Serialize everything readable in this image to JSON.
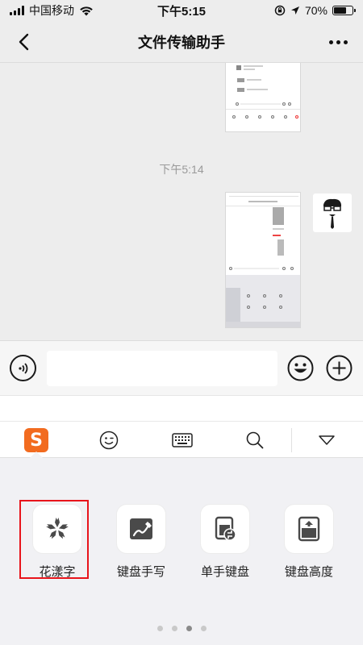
{
  "status_bar": {
    "carrier": "中国移动",
    "time": "下午5:15",
    "battery": "70%",
    "battery_level": 0.7
  },
  "nav": {
    "title": "文件传输助手"
  },
  "chat": {
    "timestamp": "下午5:14"
  },
  "keyboard": {
    "toolbar_logo": "S",
    "tools": [
      {
        "label": "花漾字",
        "icon": "flower-icon"
      },
      {
        "label": "键盘手写",
        "icon": "handwriting-icon"
      },
      {
        "label": "单手键盘",
        "icon": "one-hand-keyboard-icon"
      },
      {
        "label": "键盘高度",
        "icon": "keyboard-height-icon"
      }
    ],
    "page_count": 4,
    "active_page": 3
  },
  "colors": {
    "sogou_orange": "#f26b1f",
    "highlight_red": "#e8141b"
  }
}
